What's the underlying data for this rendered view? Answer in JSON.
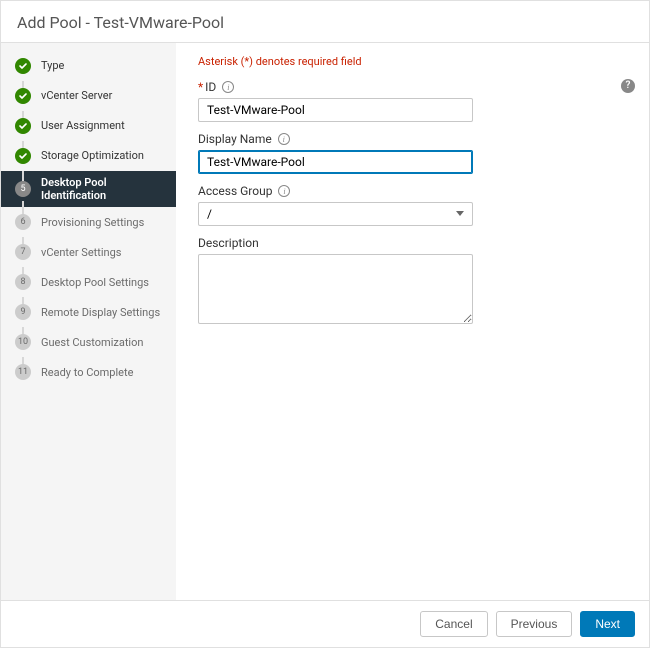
{
  "header": {
    "title": "Add Pool - Test-VMware-Pool"
  },
  "sidebar": {
    "steps": [
      {
        "num": "1",
        "label": "Type",
        "state": "completed"
      },
      {
        "num": "2",
        "label": "vCenter Server",
        "state": "completed"
      },
      {
        "num": "3",
        "label": "User Assignment",
        "state": "completed"
      },
      {
        "num": "4",
        "label": "Storage Optimization",
        "state": "completed"
      },
      {
        "num": "5",
        "label": "Desktop Pool Identification",
        "state": "current"
      },
      {
        "num": "6",
        "label": "Provisioning Settings",
        "state": "upcoming"
      },
      {
        "num": "7",
        "label": "vCenter Settings",
        "state": "upcoming"
      },
      {
        "num": "8",
        "label": "Desktop Pool Settings",
        "state": "upcoming"
      },
      {
        "num": "9",
        "label": "Remote Display Settings",
        "state": "upcoming"
      },
      {
        "num": "10",
        "label": "Guest Customization",
        "state": "upcoming"
      },
      {
        "num": "11",
        "label": "Ready to Complete",
        "state": "upcoming"
      }
    ]
  },
  "form": {
    "required_note": "Asterisk (*) denotes required field",
    "id_label": "ID",
    "id_value": "Test-VMware-Pool",
    "display_name_label": "Display Name",
    "display_name_value": "Test-VMware-Pool",
    "access_group_label": "Access Group",
    "access_group_value": "/",
    "description_label": "Description",
    "description_value": ""
  },
  "footer": {
    "cancel": "Cancel",
    "previous": "Previous",
    "next": "Next"
  },
  "help": "?"
}
